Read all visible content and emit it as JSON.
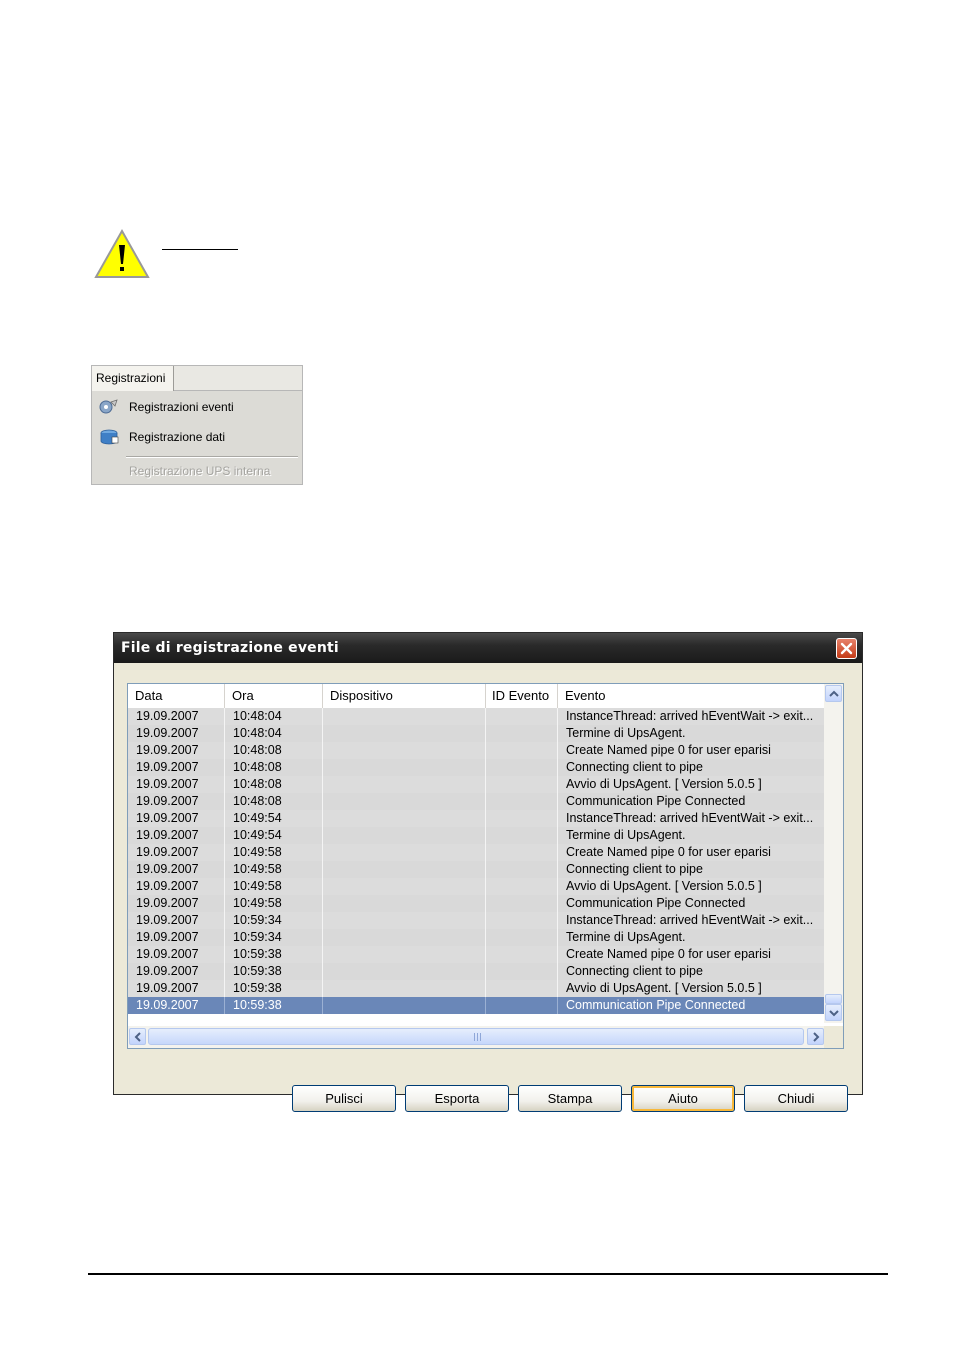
{
  "menu": {
    "tab_label": "Registrazioni",
    "items": [
      {
        "label": "Registrazioni eventi",
        "icon": "event-log-icon",
        "enabled": true
      },
      {
        "label": "Registrazione dati",
        "icon": "data-log-icon",
        "enabled": true
      },
      {
        "label": "Registrazione UPS interna",
        "icon": "",
        "enabled": false
      }
    ]
  },
  "dialog": {
    "title": "File di registrazione eventi",
    "columns": [
      "Data",
      "Ora",
      "Dispositivo",
      "ID Evento",
      "Evento"
    ],
    "rows": [
      [
        "19.09.2007",
        "10:48:04",
        "",
        "",
        "InstanceThread: arrived hEventWait -> exit..."
      ],
      [
        "19.09.2007",
        "10:48:04",
        "",
        "",
        "Termine di UpsAgent."
      ],
      [
        "19.09.2007",
        "10:48:08",
        "",
        "",
        "Create Named pipe 0 for user eparisi"
      ],
      [
        "19.09.2007",
        "10:48:08",
        "",
        "",
        "Connecting client to pipe"
      ],
      [
        "19.09.2007",
        "10:48:08",
        "",
        "",
        "Avvio di UpsAgent.   [ Version 5.0.5 ]"
      ],
      [
        "19.09.2007",
        "10:48:08",
        "",
        "",
        "Communication Pipe Connected"
      ],
      [
        "19.09.2007",
        "10:49:54",
        "",
        "",
        "InstanceThread: arrived hEventWait -> exit..."
      ],
      [
        "19.09.2007",
        "10:49:54",
        "",
        "",
        "Termine di UpsAgent."
      ],
      [
        "19.09.2007",
        "10:49:58",
        "",
        "",
        "Create Named pipe 0 for user eparisi"
      ],
      [
        "19.09.2007",
        "10:49:58",
        "",
        "",
        "Connecting client to pipe"
      ],
      [
        "19.09.2007",
        "10:49:58",
        "",
        "",
        "Avvio di UpsAgent.   [ Version 5.0.5 ]"
      ],
      [
        "19.09.2007",
        "10:49:58",
        "",
        "",
        "Communication Pipe Connected"
      ],
      [
        "19.09.2007",
        "10:59:34",
        "",
        "",
        "InstanceThread: arrived hEventWait -> exit..."
      ],
      [
        "19.09.2007",
        "10:59:34",
        "",
        "",
        "Termine di UpsAgent."
      ],
      [
        "19.09.2007",
        "10:59:38",
        "",
        "",
        "Create Named pipe 0 for user eparisi"
      ],
      [
        "19.09.2007",
        "10:59:38",
        "",
        "",
        "Connecting client to pipe"
      ],
      [
        "19.09.2007",
        "10:59:38",
        "",
        "",
        "Avvio di UpsAgent.   [ Version 5.0.5 ]"
      ],
      [
        "19.09.2007",
        "10:59:38",
        "",
        "",
        "Communication Pipe Connected"
      ]
    ],
    "selected_row": 17,
    "buttons": {
      "pulisci": "Pulisci",
      "esporta": "Esporta",
      "stampa": "Stampa",
      "aiuto": "Aiuto",
      "chiudi": "Chiudi"
    },
    "default_button": "Aiuto"
  },
  "colors": {
    "selection": "#6a87b8",
    "row_bg": "#dcdcdc",
    "close_button": "#c33b17",
    "warning_yellow": "#ffff00"
  }
}
